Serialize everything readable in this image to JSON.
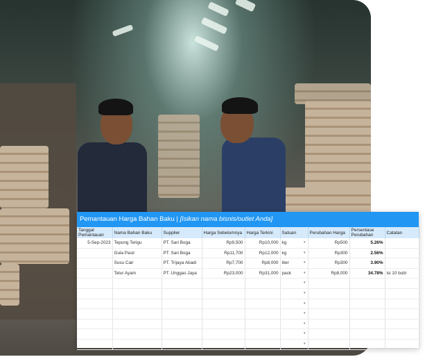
{
  "sheet": {
    "title": "Pemantauan Harga Bahan Baku | ",
    "subtitle": "[Isikan nama bisnis/outlet Anda]",
    "columns": [
      "Tanggal Pemantauan",
      "Nama Bahan Baku",
      "Supplier",
      "Harga Sebelumnya",
      "Harga Terkini",
      "Satuan",
      "Perubahan Harga",
      "Persentase Perubahan",
      "Catatan"
    ],
    "rows": [
      {
        "date": "5-Sep-2023",
        "item": "Tepung Terigu",
        "supplier": "PT. Sari Boga",
        "prev": "Rp9,500",
        "curr": "Rp10,000",
        "unit": "kg",
        "change": "Rp500",
        "pct": "5.26%",
        "note": ""
      },
      {
        "date": "",
        "item": "Gula Pasir",
        "supplier": "PT. Sari Boga",
        "prev": "Rp11,700",
        "curr": "Rp12,000",
        "unit": "kg",
        "change": "Rp300",
        "pct": "2.56%",
        "note": ""
      },
      {
        "date": "",
        "item": "Susu Cair",
        "supplier": "PT. Trijaya Abadi",
        "prev": "Rp7,700",
        "curr": "Rp8,000",
        "unit": "liter",
        "change": "Rp300",
        "pct": "3.90%",
        "note": ""
      },
      {
        "date": "",
        "item": "Telur Ayam",
        "supplier": "PT. Unggas Jaya",
        "prev": "Rp23,000",
        "curr": "Rp31,000",
        "unit": "pack",
        "change": "Rp8,000",
        "pct": "34.78%",
        "note": "isi 10 butir"
      }
    ],
    "empty_rows": 7,
    "dropdown_glyph": "▾"
  },
  "colors": {
    "header_bar": "#2196f3",
    "column_header_bg": "#d6eafb"
  },
  "icons": [
    "dropdown-arrow-icon"
  ]
}
